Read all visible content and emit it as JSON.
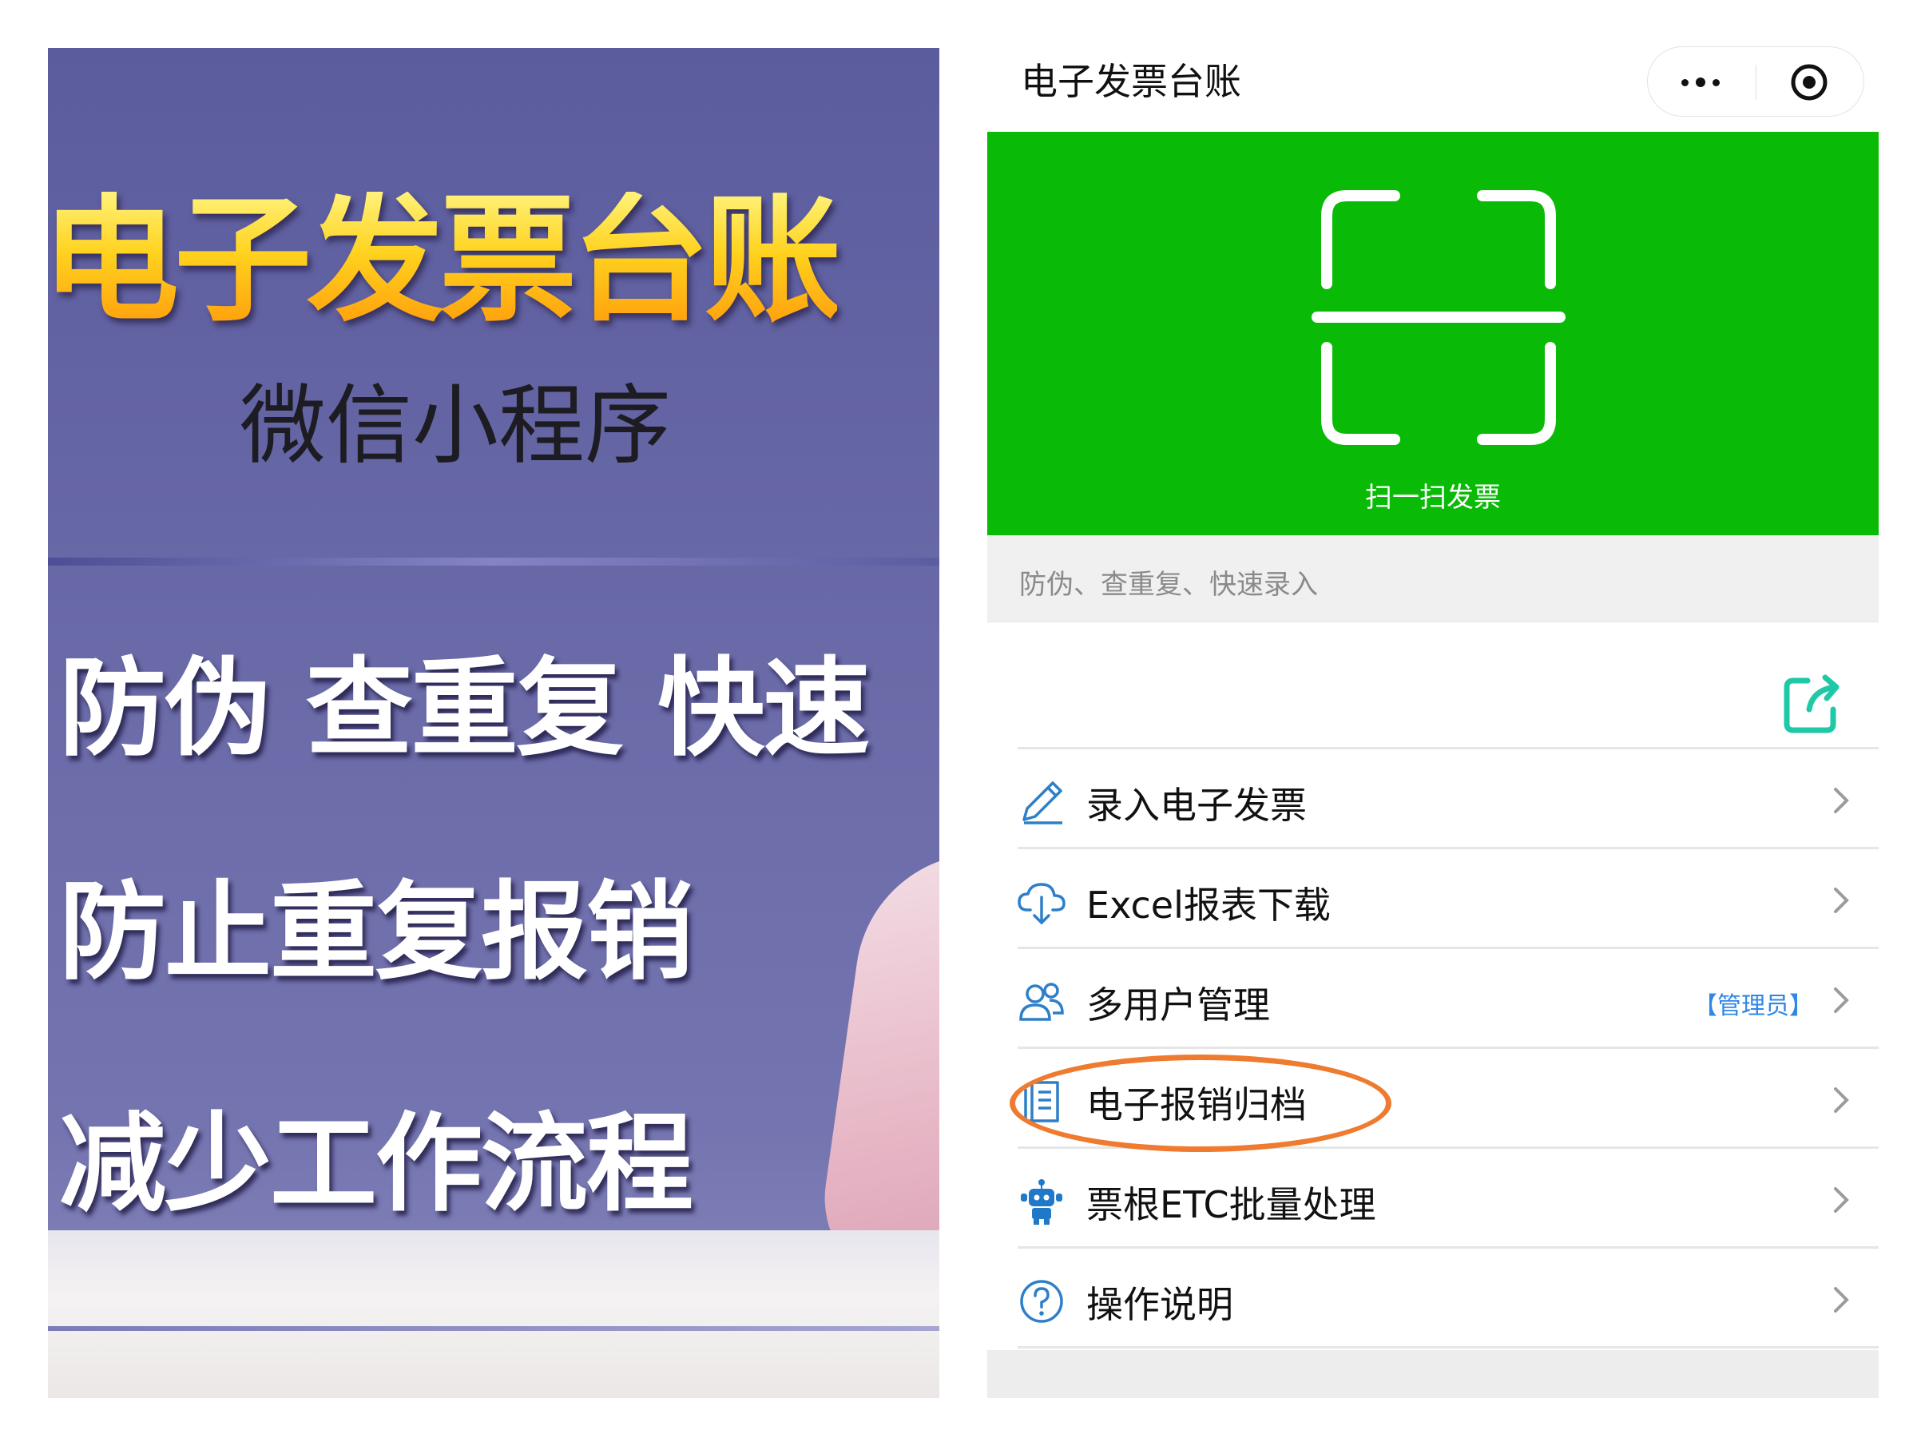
{
  "promo": {
    "title": "电子发票台账",
    "subtitle": "微信小程序",
    "lines": [
      "防伪 查重复 快速",
      "防止重复报销",
      "减少工作流程"
    ]
  },
  "app": {
    "title": "电子发票台账",
    "accent_color": "#09bb07",
    "link_color": "#2f87e6",
    "highlight_color": "#ee7b2f",
    "capsule": {
      "more_icon": "more-dots-icon",
      "close_icon": "target-close-icon"
    },
    "scan": {
      "label": "扫一扫发票",
      "icon": "scan-frame-icon"
    },
    "tagline": "防伪、查重复、快速录入",
    "share_icon": "share-icon",
    "menu": [
      {
        "label": "录入电子发票",
        "icon": "pencil-icon",
        "tag": ""
      },
      {
        "label": "Excel报表下载",
        "icon": "cloud-download-icon",
        "tag": ""
      },
      {
        "label": "多用户管理",
        "icon": "users-icon",
        "tag": "【管理员】"
      },
      {
        "label": "电子报销归档",
        "icon": "archive-document-icon",
        "tag": "",
        "highlighted": true
      },
      {
        "label": "票根ETC批量处理",
        "icon": "robot-icon",
        "tag": ""
      },
      {
        "label": "操作说明",
        "icon": "help-circle-icon",
        "tag": ""
      }
    ]
  }
}
